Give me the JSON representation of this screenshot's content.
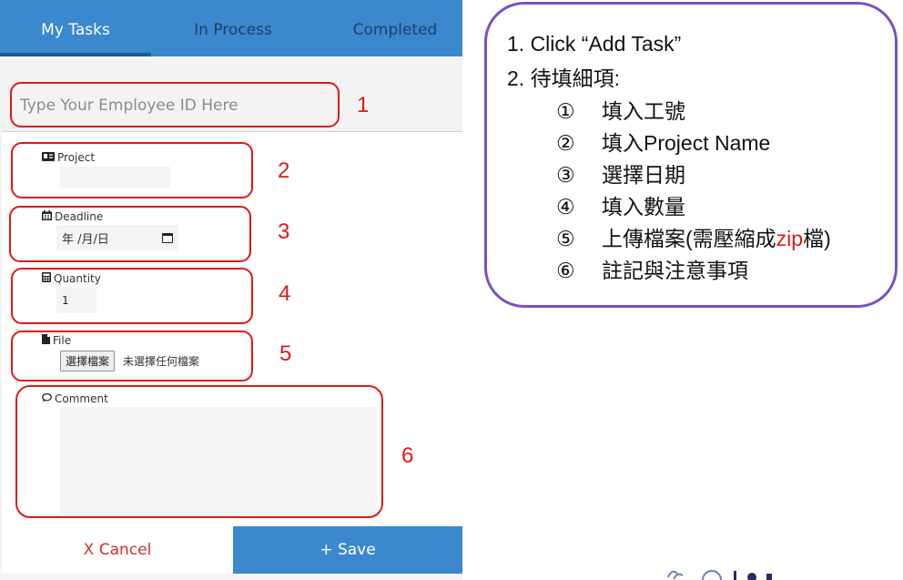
{
  "tabs": [
    {
      "label": "My Tasks",
      "active": true
    },
    {
      "label": "In Process",
      "active": false
    },
    {
      "label": "Completed",
      "active": false
    }
  ],
  "form": {
    "employee_id": {
      "placeholder": "Type Your Employee ID Here",
      "value": ""
    },
    "project": {
      "label": "Project",
      "icon": "id-card-icon",
      "value": ""
    },
    "deadline": {
      "label": "Deadline",
      "icon": "calendar-icon",
      "value": "年 /月/日"
    },
    "quantity": {
      "label": "Quantity",
      "icon": "calculator-icon",
      "value": "1"
    },
    "file": {
      "label": "File",
      "icon": "file-icon",
      "button": "選擇檔案",
      "status": "未選擇任何檔案"
    },
    "comment": {
      "label": "Comment",
      "icon": "comment-icon",
      "value": ""
    }
  },
  "actions": {
    "cancel": "X Cancel",
    "save": "+ Save"
  },
  "annotations": [
    "1",
    "2",
    "3",
    "4",
    "5",
    "6"
  ],
  "callout": {
    "line1": "1. Click “Add Task”",
    "line2": "2. 待填細項:",
    "steps": [
      {
        "num": "①",
        "text": "填入工號"
      },
      {
        "num": "②",
        "text": "填入Project Name"
      },
      {
        "num": "③",
        "text": "選擇日期"
      },
      {
        "num": "④",
        "text": "填入數量"
      },
      {
        "num": "⑤",
        "text_before": "上傳檔案(需壓縮成",
        "highlight": "zip",
        "text_after": "檔)"
      },
      {
        "num": "⑥",
        "text": "註記與注意事項"
      }
    ]
  },
  "colors": {
    "tab_bar": "#3b88cf",
    "annotation_red": "#e01818",
    "callout_border": "#7a4fc7"
  }
}
